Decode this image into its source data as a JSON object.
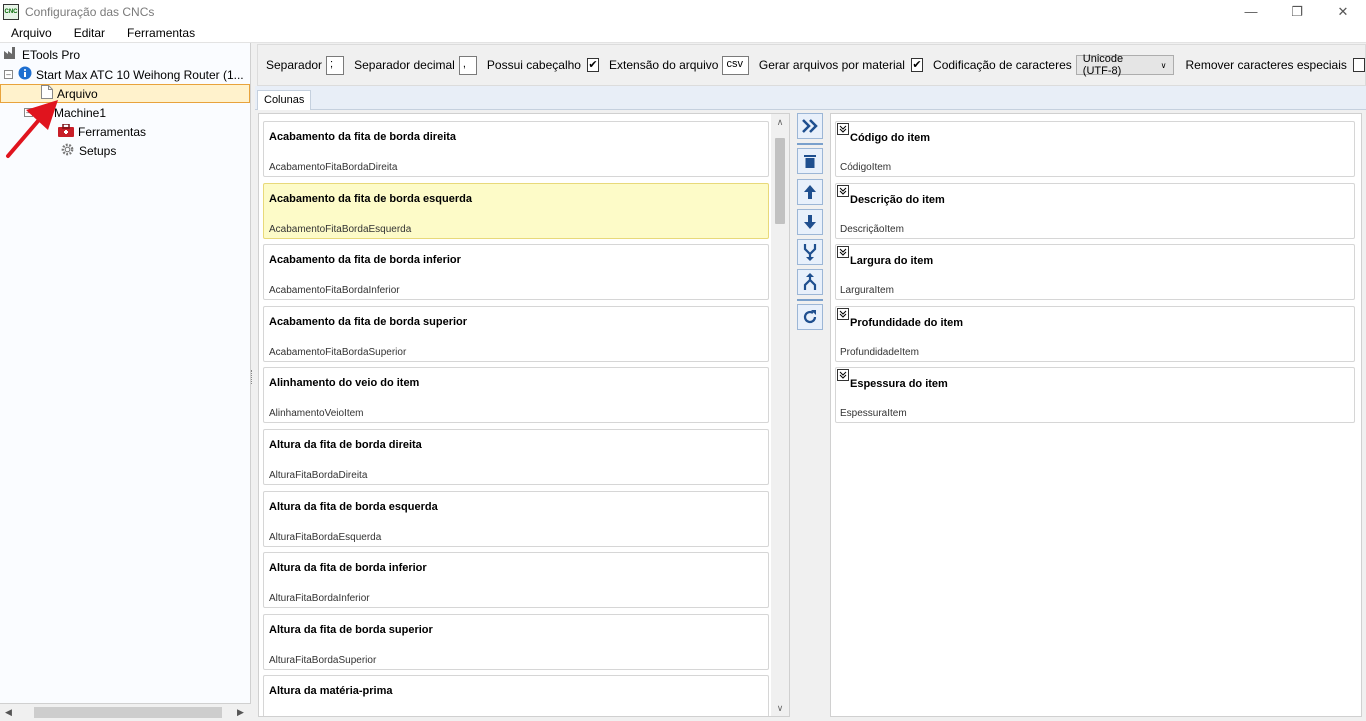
{
  "window": {
    "title": "Configuração das CNCs",
    "icon_label": "CNC"
  },
  "menu": [
    "Arquivo",
    "Editar",
    "Ferramentas"
  ],
  "tree": {
    "root": "ETools Pro",
    "machine": "Start Max ATC 10 Weihong Router (1...",
    "selected": "Arquivo",
    "machine1": "Machine1",
    "tools": "Ferramentas",
    "setups": "Setups"
  },
  "options": {
    "separator_label": "Separador",
    "separator_value": ";",
    "decimal_label": "Separador decimal",
    "decimal_value": ",",
    "header_label": "Possui cabeçalho",
    "header_checked": true,
    "extension_label": "Extensão do arquivo",
    "extension_value": "csv",
    "per_material_label": "Gerar arquivos por material",
    "per_material_checked": true,
    "encoding_label": "Codificação de caracteres",
    "encoding_value": "Unicode (UTF-8)",
    "remove_special_label": "Remover caracteres especiais",
    "remove_special_checked": false
  },
  "tabs": [
    "Colunas"
  ],
  "available_columns": [
    {
      "title": "Acabamento da fita de borda direita",
      "key": "AcabamentoFitaBordaDireita"
    },
    {
      "title": "Acabamento da fita de borda esquerda",
      "key": "AcabamentoFitaBordaEsquerda"
    },
    {
      "title": "Acabamento da fita de borda inferior",
      "key": "AcabamentoFitaBordaInferior"
    },
    {
      "title": "Acabamento da fita de borda superior",
      "key": "AcabamentoFitaBordaSuperior"
    },
    {
      "title": "Alinhamento do veio do item",
      "key": "AlinhamentoVeioItem"
    },
    {
      "title": "Altura da fita de borda direita",
      "key": "AlturaFitaBordaDireita"
    },
    {
      "title": "Altura da fita de borda esquerda",
      "key": "AlturaFitaBordaEsquerda"
    },
    {
      "title": "Altura da fita de borda inferior",
      "key": "AlturaFitaBordaInferior"
    },
    {
      "title": "Altura da fita de borda superior",
      "key": "AlturaFitaBordaSuperior"
    },
    {
      "title": "Altura da matéria-prima",
      "key": ""
    }
  ],
  "highlighted_index": 1,
  "selected_columns": [
    {
      "title": "Código do item",
      "key": "CódigoItem"
    },
    {
      "title": "Descrição do item",
      "key": "DescriçãoItem"
    },
    {
      "title": "Largura do item",
      "key": "LarguraItem"
    },
    {
      "title": "Profundidade do item",
      "key": "ProfundidadeItem"
    },
    {
      "title": "Espessura do item",
      "key": "EspessuraItem"
    }
  ],
  "colors": {
    "highlight": "#fdfbc8",
    "selection_border": "#e8a33c",
    "arrow": "#e0141e",
    "button_icon": "#1f4f8f"
  }
}
